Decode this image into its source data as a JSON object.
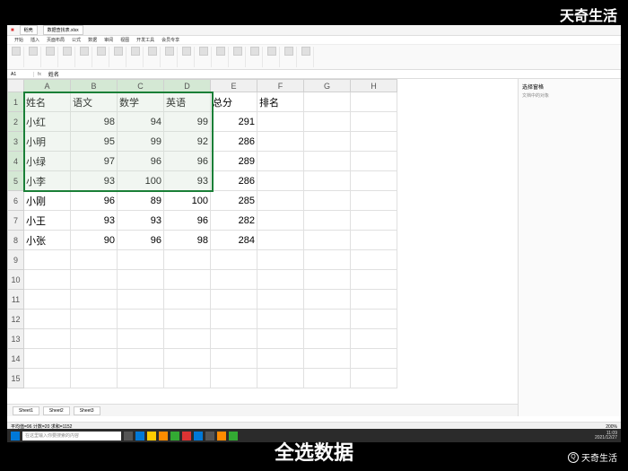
{
  "app": {
    "tab1": "稻壳",
    "tab2": "数据查找表.xlsx",
    "ribbonTabs": [
      "开始",
      "插入",
      "页面布局",
      "公式",
      "数据",
      "审阅",
      "视图",
      "开发工具",
      "会员专享"
    ],
    "cellRef": "A1",
    "cellValue": "姓名",
    "sidePanel": "选择窗格",
    "sideSub": "文档中的对象"
  },
  "columns": [
    "A",
    "B",
    "C",
    "D",
    "E",
    "F",
    "G",
    "H"
  ],
  "headers": {
    "A": "姓名",
    "B": "语文",
    "C": "数学",
    "D": "英语",
    "E": "总分",
    "F": "排名"
  },
  "rows": [
    {
      "n": "小红",
      "c": 98,
      "m": 94,
      "e": 99,
      "t": 291
    },
    {
      "n": "小明",
      "c": 95,
      "m": 99,
      "e": 92,
      "t": 286
    },
    {
      "n": "小绿",
      "c": 97,
      "m": 96,
      "e": 96,
      "t": 289
    },
    {
      "n": "小李",
      "c": 93,
      "m": 100,
      "e": 93,
      "t": 286
    },
    {
      "n": "小刚",
      "c": 96,
      "m": 89,
      "e": 100,
      "t": 285
    },
    {
      "n": "小王",
      "c": 93,
      "m": 93,
      "e": 96,
      "t": 282
    },
    {
      "n": "小张",
      "c": 90,
      "m": 96,
      "e": 98,
      "t": 284
    }
  ],
  "sheets": [
    "Sheet1",
    "Sheet2",
    "Sheet3"
  ],
  "status": "平均值=96 计数=20 求和=1152",
  "zoom": "200%",
  "taskbar": {
    "search": "在这里输入你要搜索的内容",
    "time": "11:09",
    "date": "2021/12/27"
  },
  "caption": "全选数据",
  "watermark": "天奇生活"
}
